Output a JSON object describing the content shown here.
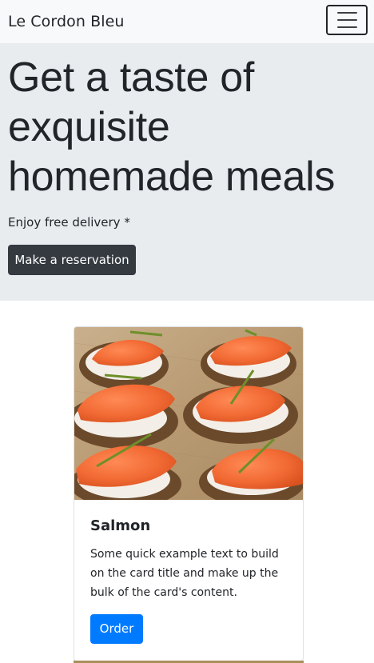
{
  "navbar": {
    "brand": "Le Cordon Bleu",
    "toggler_icon": "hamburger-menu-icon"
  },
  "hero": {
    "title": "Get a taste of exquisite homemade meals",
    "subtitle": "Enjoy free delivery *",
    "cta_label": "Make a reservation"
  },
  "card": {
    "image_icon": "salmon-canape-photo",
    "title": "Salmon",
    "text": "Some quick example text to build on the card title and make up the bulk of the card's content.",
    "button_label": "Order"
  },
  "colors": {
    "navbar_bg": "#f8f9fa",
    "hero_bg": "#e9ecef",
    "dark_button": "#343a40",
    "primary_button": "#007bff",
    "text": "#212529"
  }
}
